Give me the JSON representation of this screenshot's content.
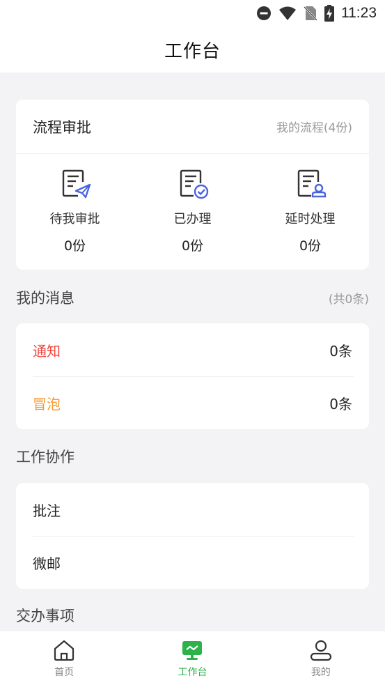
{
  "status_bar": {
    "time": "11:23"
  },
  "header": {
    "title": "工作台"
  },
  "process": {
    "title": "流程审批",
    "my_process": "我的流程(4份)",
    "items": [
      {
        "label": "待我审批",
        "count": "0份",
        "icon": "document-send-icon"
      },
      {
        "label": "已办理",
        "count": "0份",
        "icon": "document-check-icon"
      },
      {
        "label": "延时处理",
        "count": "0份",
        "icon": "document-user-icon"
      }
    ]
  },
  "messages": {
    "title": "我的消息",
    "total": "(共0条)",
    "items": [
      {
        "label": "通知",
        "value": "0条",
        "color": "#f0443a"
      },
      {
        "label": "冒泡",
        "value": "0条",
        "color": "#f59a2f"
      }
    ]
  },
  "collab": {
    "title": "工作协作",
    "items": [
      {
        "label": "批注"
      },
      {
        "label": "微邮"
      }
    ]
  },
  "assign": {
    "title": "交办事项"
  },
  "tabs": [
    {
      "label": "首页",
      "icon": "home-icon",
      "active": false
    },
    {
      "label": "工作台",
      "icon": "monitor-icon",
      "active": true
    },
    {
      "label": "我的",
      "icon": "user-icon",
      "active": false
    }
  ],
  "colors": {
    "accent": "#2db24b",
    "icon_blue": "#4a63e0"
  }
}
